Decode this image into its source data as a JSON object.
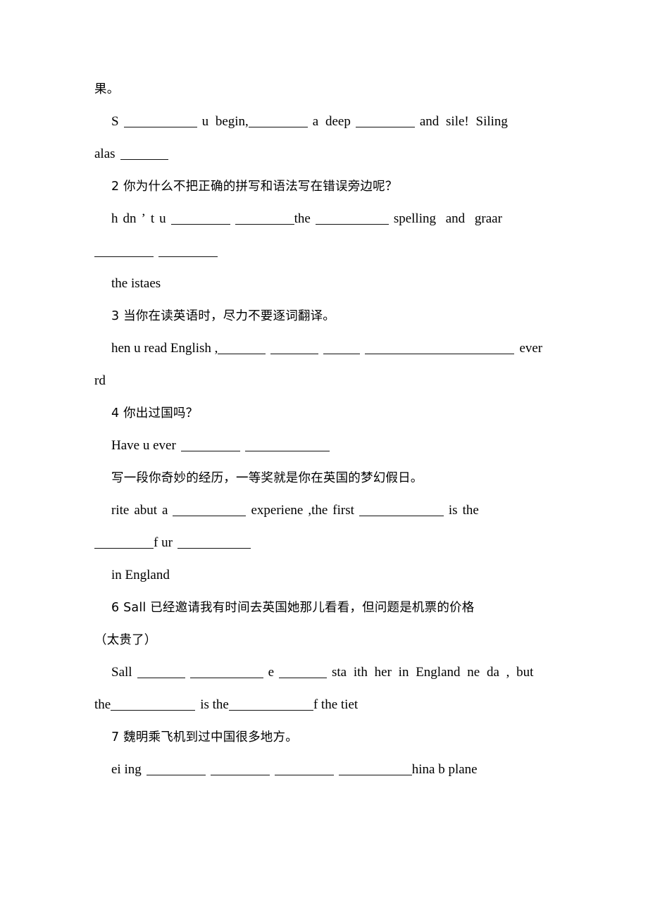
{
  "document": {
    "type": "scanned-worksheet",
    "language_mix": "Chinese and English",
    "background_color": "#ffffff",
    "text_color": "#000000"
  },
  "lines": {
    "l1_fruit_tail": "果。",
    "l2_s_begin": "S",
    "l2_mid1": "u begin,",
    "l2_mid2": "a deep",
    "l2_tail": "and sile! Siling",
    "l3_alas": "alas",
    "q2_cn": "2 你为什么不把正确的拼写和语法写在错误旁边呢？",
    "q2_en_a": "h",
    "q2_en_b": "dn",
    "q2_apos": "’",
    "q2_en_c": "t",
    "q2_en_d": "u",
    "q2_the": "the",
    "q2_tail": "spelling and graar",
    "q2_next": "the istaes",
    "q3_cn": "3 当你在读英语时，尽力不要逐词翻译。",
    "q3_en_head": "hen u read English ,",
    "q3_en_tail": "ever",
    "q3_en_wrap": "rd",
    "q4_cn": "4 你出过国吗？",
    "q4_en_head": "Have u ever",
    "q5_cn": "写一段你奇妙的经历，一等奖就是你在英国的梦幻假日。",
    "q5_en_a": "rite",
    "q5_en_b": "abut",
    "q5_en_c": "a",
    "q5_en_d": "experiene",
    "q5_en_e": ",the",
    "q5_en_f": "first",
    "q5_en_g": "is",
    "q5_en_h": "the",
    "q5_wrap_a": "f ur",
    "q5_wrap_b": "in England",
    "q6_cn_1": "6 Sall 已经邀请我有时间去英国她那儿看看，但问题是机票的价格",
    "q6_cn_2": "（太贵了）",
    "q6_en_a": "Sall",
    "q6_en_b": "e",
    "q6_en_c": "sta ith her in England ne da , but",
    "q6_en_d": "the",
    "q6_en_e": "is the",
    "q6_en_f": "f the tiet",
    "q7_cn": "7 魏明乘飞机到过中国很多地方。",
    "q7_en_head": "ei ing",
    "q7_en_tail": "hina b plane"
  }
}
